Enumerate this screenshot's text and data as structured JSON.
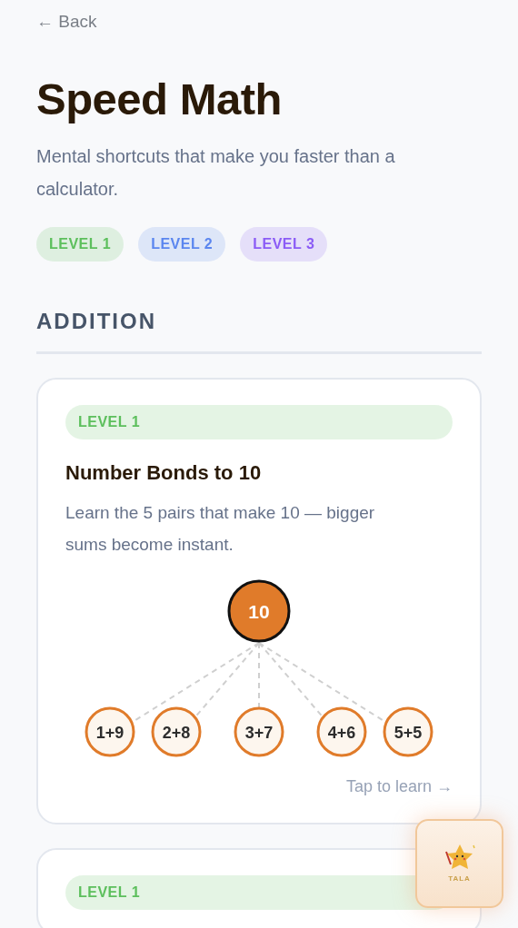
{
  "back_link": {
    "label": "← Back"
  },
  "title": "Speed Math",
  "subtitle": "Mental shortcuts that make you faster than a calculator.",
  "levels": [
    {
      "label": "LEVEL 1",
      "color": "#5cbf5c"
    },
    {
      "label": "LEVEL 2",
      "color": "#5b86ef"
    },
    {
      "label": "LEVEL 3",
      "color": "#8b5cf6"
    }
  ],
  "section": {
    "title": "ADDITION"
  },
  "cards": [
    {
      "level_badge": {
        "label": "LEVEL 1",
        "color": "#5cbf5c"
      },
      "title": "Number Bonds to 10",
      "description": "Learn the 5 pairs that make 10 — bigger sums become instant.",
      "diagram": {
        "root": "10",
        "parts": [
          "1+9",
          "2+8",
          "3+7",
          "4+6",
          "5+5"
        ]
      },
      "action": "Tap to learn →"
    },
    {
      "level_badge": {
        "label": "LEVEL 1",
        "color": "#5cbf5c"
      }
    }
  ],
  "assistant_button": {
    "label": "TALA"
  }
}
